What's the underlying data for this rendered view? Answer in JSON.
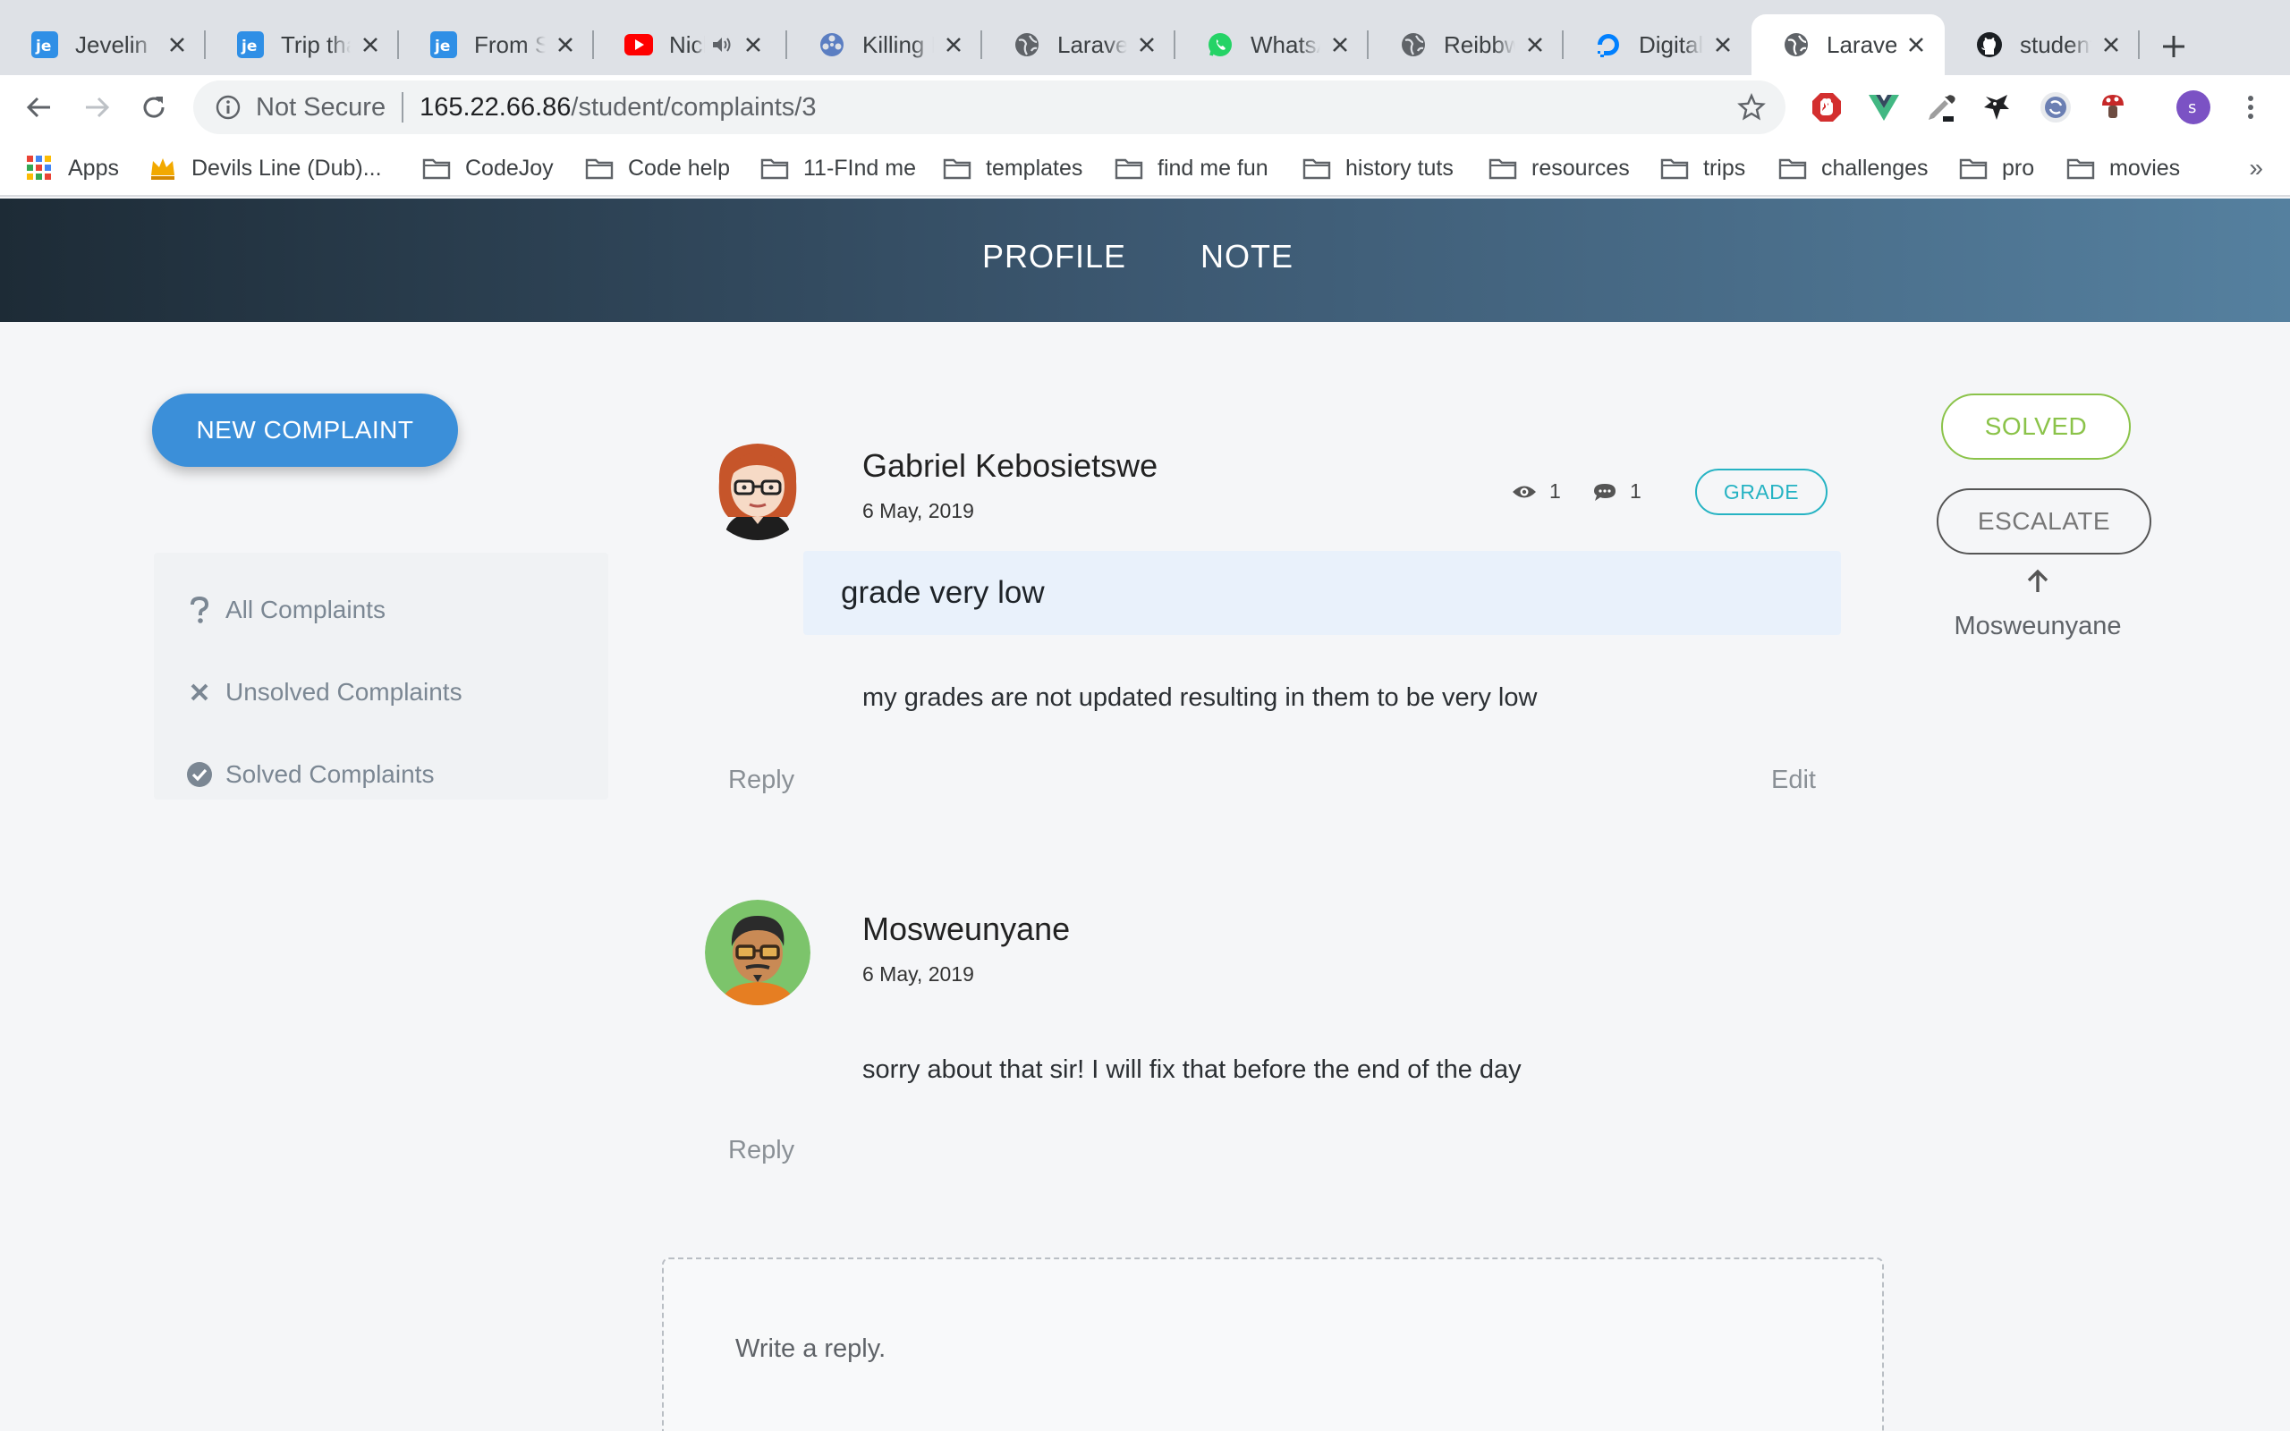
{
  "browser": {
    "tabs": [
      {
        "title": "Jevelin",
        "icon": "jevelin-favicon",
        "active": false
      },
      {
        "title": "Trip tha",
        "icon": "jevelin-favicon",
        "active": false
      },
      {
        "title": "From Si",
        "icon": "jevelin-favicon",
        "active": false
      },
      {
        "title": "Nick",
        "icon": "youtube-favicon",
        "active": false,
        "audio": true
      },
      {
        "title": "Killing E",
        "icon": "film-reel-favicon",
        "active": false
      },
      {
        "title": "Laravel",
        "icon": "globe-favicon",
        "active": false
      },
      {
        "title": "WhatsA",
        "icon": "whatsapp-favicon",
        "active": false
      },
      {
        "title": "Reibbw",
        "icon": "globe-favicon",
        "active": false
      },
      {
        "title": "DigitalC",
        "icon": "digitalocean-favicon",
        "active": false
      },
      {
        "title": "Laravel",
        "icon": "globe-favicon",
        "active": true
      },
      {
        "title": "student",
        "icon": "github-favicon",
        "active": false
      }
    ],
    "address": {
      "security_label": "Not Secure",
      "host": "165.22.66.86",
      "path": "/student/complaints/3"
    },
    "profile_initial": "s",
    "bookmarks": [
      {
        "label": "Apps",
        "icon": "apps-grid-icon"
      },
      {
        "label": "Devils Line (Dub)...",
        "icon": "crown-icon"
      },
      {
        "label": "CodeJoy",
        "icon": "folder-icon"
      },
      {
        "label": "Code help",
        "icon": "folder-icon"
      },
      {
        "label": "11-FInd me",
        "icon": "folder-icon"
      },
      {
        "label": "templates",
        "icon": "folder-icon"
      },
      {
        "label": "find me fun",
        "icon": "folder-icon"
      },
      {
        "label": "history tuts",
        "icon": "folder-icon"
      },
      {
        "label": "resources",
        "icon": "folder-icon"
      },
      {
        "label": "trips",
        "icon": "folder-icon"
      },
      {
        "label": "challenges",
        "icon": "folder-icon"
      },
      {
        "label": "pro",
        "icon": "folder-icon"
      },
      {
        "label": "movies",
        "icon": "folder-icon"
      }
    ],
    "bookmarks_more": "»"
  },
  "nav": {
    "profile": "PROFILE",
    "note": "NOTE"
  },
  "sidebar": {
    "new_complaint": "NEW COMPLAINT",
    "filters": [
      {
        "label": "All Complaints",
        "icon": "question-icon"
      },
      {
        "label": "Unsolved Complaints",
        "icon": "x-icon"
      },
      {
        "label": "Solved Complaints",
        "icon": "check-circle-icon"
      }
    ]
  },
  "complaint": {
    "author": "Gabriel Kebosietswe",
    "date": "6 May, 2019",
    "views": "1",
    "comments": "1",
    "category": "GRADE",
    "subject": "grade very low",
    "body": "my grades are not updated resulting in them to be very low",
    "reply_label": "Reply",
    "edit_label": "Edit"
  },
  "replies": [
    {
      "author": "Mosweunyane",
      "date": "6 May, 2019",
      "body": "sorry about that sir! I will fix that before the end of the day",
      "reply_label": "Reply"
    }
  ],
  "status_panel": {
    "solved": "SOLVED",
    "escalate": "ESCALATE",
    "escalated_to": "Mosweunyane"
  },
  "reply_box": {
    "placeholder": "Write a reply."
  },
  "colors": {
    "accent_blue": "#3b8fd9",
    "solved_green": "#8bc34a",
    "tag_teal": "#26b3c3",
    "subject_bg": "#e9f1fb",
    "nav_gradient_start": "#1d2b36",
    "nav_gradient_end": "#55809f"
  }
}
